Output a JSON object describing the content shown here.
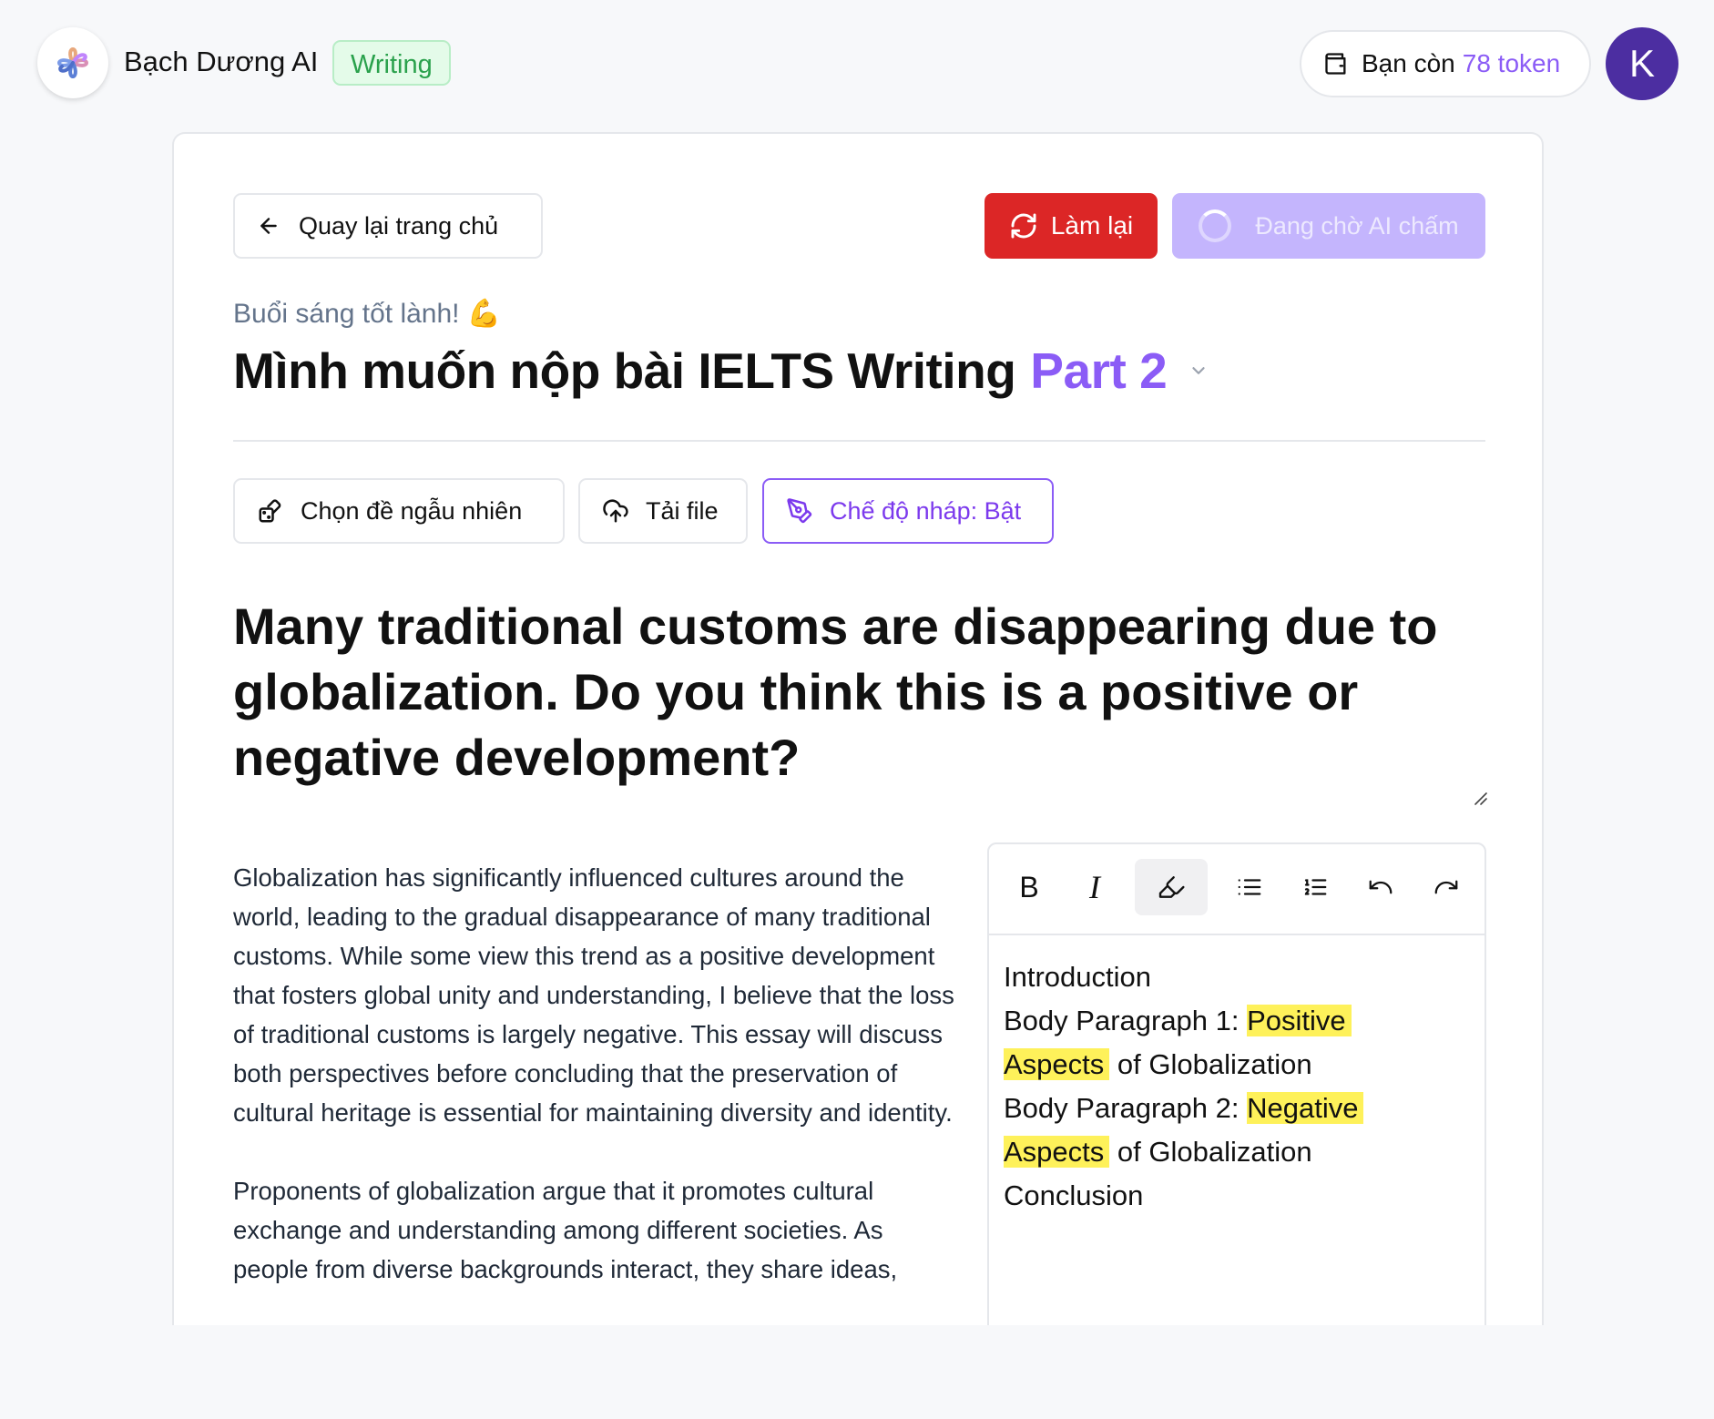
{
  "header": {
    "brand": "Bạch Dương AI",
    "badge": "Writing",
    "token_prefix": "Bạn còn",
    "token_value": "78 token",
    "avatar_initial": "K"
  },
  "actions": {
    "back": "Quay lại trang chủ",
    "redo": "Làm lại",
    "waiting": "Đang chờ AI chấm"
  },
  "intro": {
    "greeting": "Buổi sáng tốt lành! 💪",
    "title": "Mình muốn nộp bài IELTS Writing",
    "part": "Part 2"
  },
  "tools": {
    "random": "Chọn đề ngẫu nhiên",
    "upload": "Tải file",
    "draft": "Chế độ nháp: Bật"
  },
  "question": "Many traditional customs are disappearing due to globalization. Do you think this is a positive or negative development?",
  "essay": {
    "p1": "Globalization has significantly influenced cultures around the world, leading to the gradual disappearance of many traditional customs. While some view this trend as a positive development that fosters global unity and understanding, I believe that the loss of traditional customs is largely negative. This essay will discuss both perspectives before concluding that the preservation of cultural heritage is essential for maintaining diversity and identity.",
    "p2": "Proponents of globalization argue that it promotes cultural exchange and understanding among different societies. As people from diverse backgrounds interact, they share ideas,"
  },
  "editor": {
    "toolbar": {
      "bold": "B",
      "italic": "I"
    },
    "lines": {
      "l1": "Introduction",
      "l2a": "Body Paragraph 1: ",
      "l2b": "Positive",
      "l3a": "Aspects",
      "l3b": " of Globalization",
      "l4a": "Body Paragraph 2: ",
      "l4b": "Negative",
      "l5a": "Aspects",
      "l5b": " of Globalization",
      "l6": "Conclusion"
    }
  },
  "colors": {
    "accent": "#8b5cf6",
    "danger": "#dc2626",
    "badge_green": "#2aa14c",
    "highlight": "#fef15a",
    "avatar": "#4c2ea1"
  }
}
